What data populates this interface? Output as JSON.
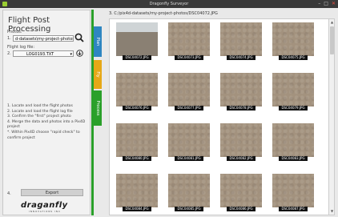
{
  "window": {
    "title": "Dragonfly Surveyor",
    "controls": [
      "–",
      "□",
      "✕"
    ]
  },
  "panel": {
    "title": "Flight Post Processing",
    "photos_label": "Photos:",
    "step1": "1.",
    "photos_value": "d-datasets\\my-project-photos",
    "flightlog_label": "Flight log file:",
    "step2": "2.",
    "flightlog_value": "LOG0193.TXT",
    "instructions": [
      "1. Locate and load the flight photos",
      "2. Locate and load the flight log file",
      "3. Confirm the \"first\" project photo",
      "4. Merge the data and photos into a Pix4D project",
      "*. Within Pix4D choose \"rapid check\" to confirm project"
    ],
    "step4": "4.",
    "export_label": "Export",
    "logo_text": "draganfly",
    "logo_sub": "INNOVATIONS INC"
  },
  "tabs": [
    {
      "label": "Plan",
      "color": "#2e86c1"
    },
    {
      "label": "Fly",
      "color": "#e6a817"
    },
    {
      "label": "Process",
      "color": "#2aa02a"
    }
  ],
  "gallery": {
    "path": "3. C:/pix4d-datasets/my-project-photos/DSC04072.JPG",
    "selected": "DSC04072.JPG",
    "photos": [
      "DSC04072.JPG",
      "DSC04073.JPG",
      "DSC04074.JPG",
      "DSC04075.JPG",
      "DSC04076.JPG",
      "DSC04077.JPG",
      "DSC04078.JPG",
      "DSC04079.JPG",
      "DSC04080.JPG",
      "DSC04081.JPG",
      "DSC04082.JPG",
      "DSC04083.JPG",
      "DSC04084.JPG",
      "DSC04085.JPG",
      "DSC04086.JPG",
      "DSC04087.JPG"
    ]
  }
}
